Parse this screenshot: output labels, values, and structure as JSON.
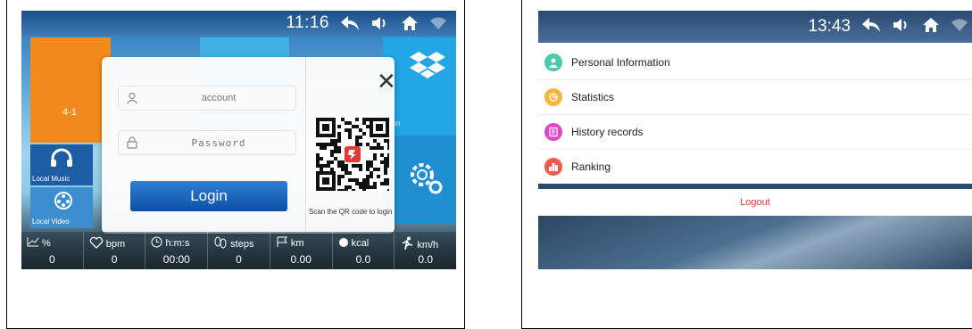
{
  "left_screen": {
    "status": {
      "time": "11:16"
    },
    "tiles": {
      "orange_label": "4-1",
      "apps_label": "ation",
      "music_label": "Local Music",
      "video_label": "Local Video"
    },
    "login_dialog": {
      "account_placeholder": "account",
      "password_placeholder": "Password",
      "login_label": "Login",
      "close_label": "✕",
      "qr_caption": "Scan the QR code to login"
    },
    "metrics": [
      {
        "unit": "%",
        "value": "0",
        "icon": "chart-icon"
      },
      {
        "unit": "bpm",
        "value": "0",
        "icon": "heart-icon"
      },
      {
        "unit": "h:m:s",
        "value": "00:00",
        "icon": "clock-icon"
      },
      {
        "unit": "steps",
        "value": "0",
        "icon": "footprints-icon"
      },
      {
        "unit": "km",
        "value": "0.00",
        "icon": "flag-icon"
      },
      {
        "unit": "kcal",
        "value": "0.0",
        "icon": "flame-icon"
      },
      {
        "unit": "km/h",
        "value": "0.0",
        "icon": "runner-icon"
      }
    ]
  },
  "right_screen": {
    "status": {
      "time": "13:43"
    },
    "menu": [
      {
        "label": "Personal Information",
        "color": "#4cc9a6",
        "icon": "person-icon"
      },
      {
        "label": "Statistics",
        "color": "#f6b73c",
        "icon": "statistics-icon"
      },
      {
        "label": "History records",
        "color": "#e346c8",
        "icon": "history-icon"
      },
      {
        "label": "Ranking",
        "color": "#ef5a4a",
        "icon": "ranking-icon"
      }
    ],
    "logout_label": "Logout"
  },
  "colors": {
    "accent_blue": "#1f6cc4",
    "orange_tile": "#f08a1c",
    "logout_red": "#e53935"
  }
}
